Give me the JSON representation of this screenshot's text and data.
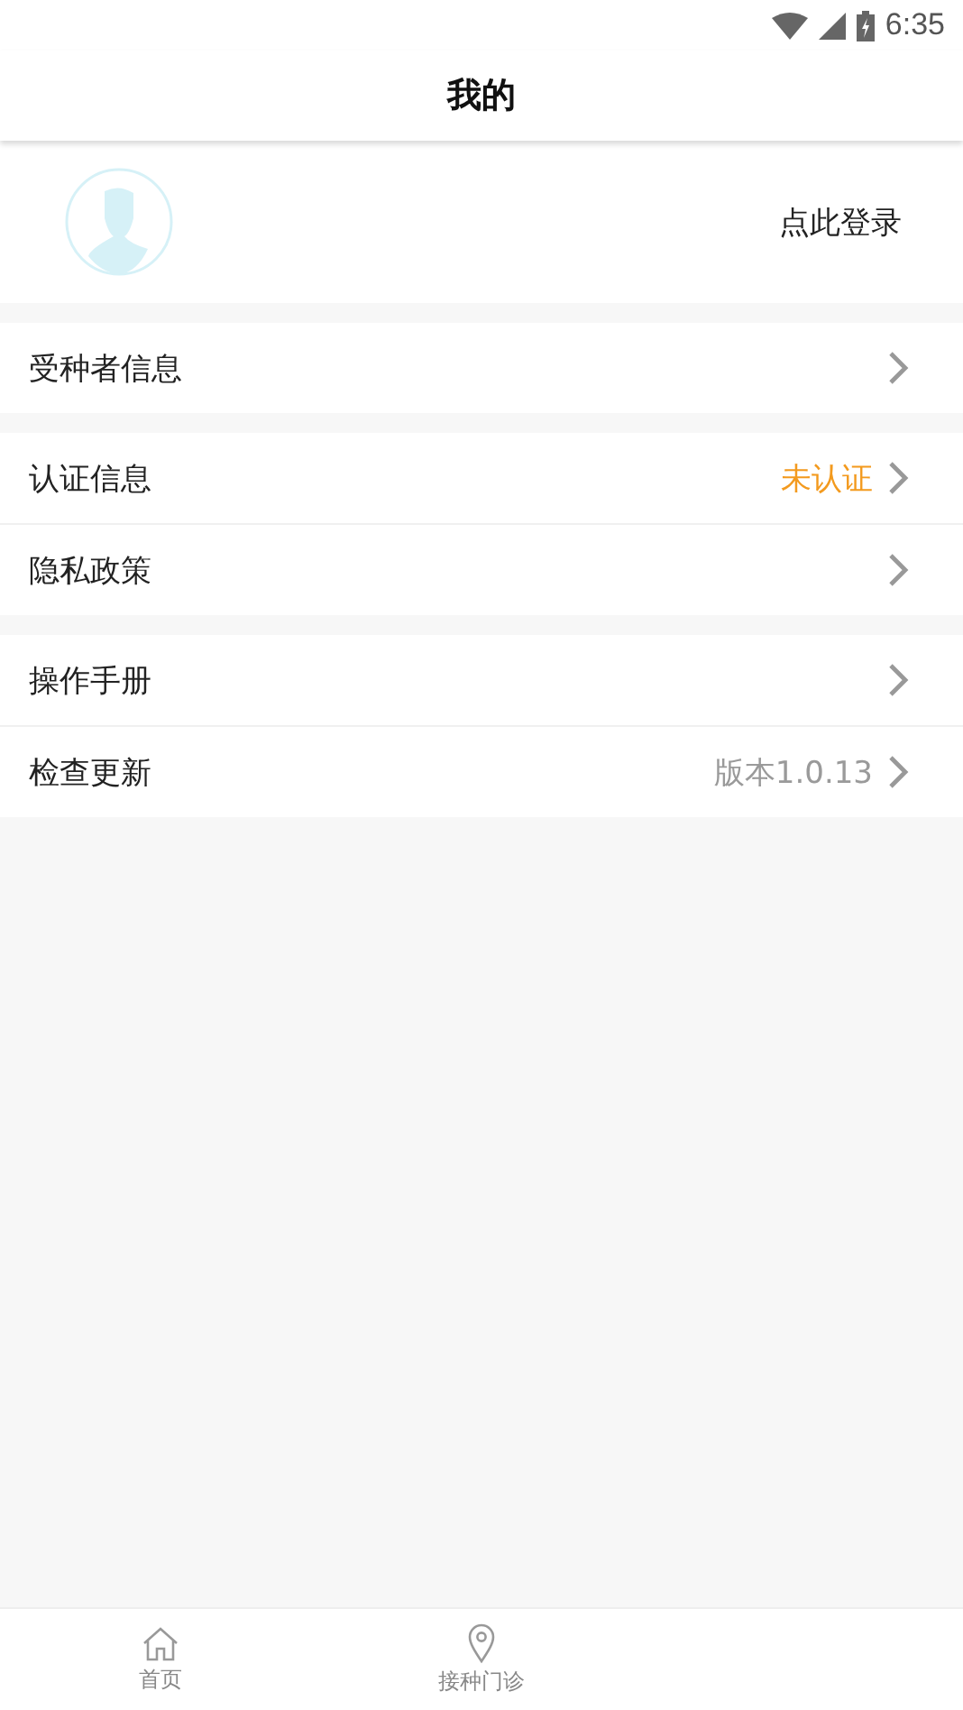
{
  "status_bar": {
    "time": "6:35"
  },
  "header": {
    "title": "我的"
  },
  "profile": {
    "login_label": "点此登录"
  },
  "menu_groups": [
    {
      "items": [
        {
          "label": "受种者信息",
          "kind": "link"
        }
      ]
    },
    {
      "items": [
        {
          "label": "认证信息",
          "value": "未认证",
          "kind": "status"
        },
        {
          "label": "隐私政策",
          "kind": "link"
        }
      ]
    },
    {
      "items": [
        {
          "label": "操作手册",
          "kind": "link"
        },
        {
          "label": "检查更新",
          "value": "版本1.0.13",
          "kind": "info"
        }
      ]
    }
  ],
  "tab_bar": {
    "tabs": [
      {
        "label": "首页",
        "kind": "home",
        "selected": false
      },
      {
        "label": "接种门诊",
        "kind": "pin",
        "selected": false
      }
    ]
  }
}
